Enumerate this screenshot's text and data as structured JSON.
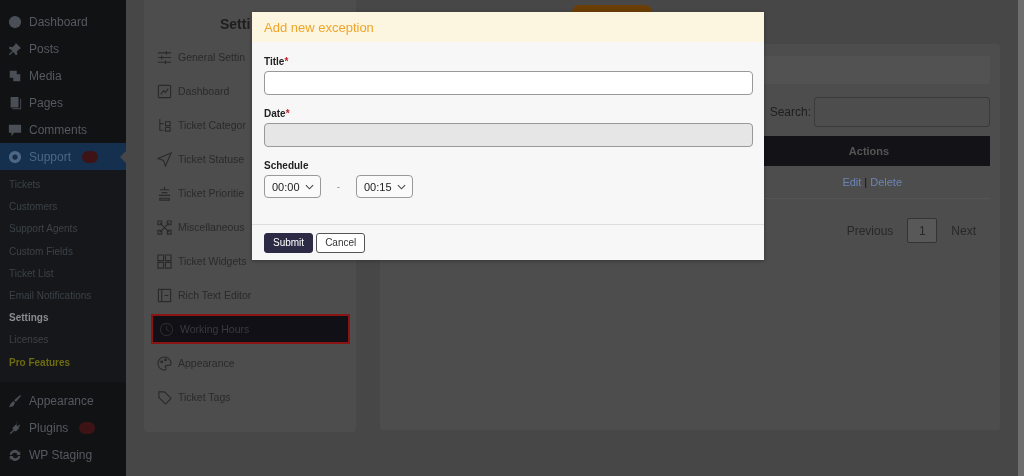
{
  "admin_menu": {
    "top": [
      {
        "label": "Dashboard",
        "selected": false,
        "badge": false
      },
      {
        "label": "Posts",
        "selected": false,
        "badge": false
      },
      {
        "label": "Media",
        "selected": false,
        "badge": false
      },
      {
        "label": "Pages",
        "selected": false,
        "badge": false
      },
      {
        "label": "Comments",
        "selected": false,
        "badge": false
      },
      {
        "label": "Support",
        "selected": true,
        "badge": true
      }
    ],
    "submenu": [
      {
        "label": "Tickets",
        "selected": false,
        "kind": "link"
      },
      {
        "label": "Customers",
        "selected": false,
        "kind": "link"
      },
      {
        "label": "Support Agents",
        "selected": false,
        "kind": "link"
      },
      {
        "label": "Custom Fields",
        "selected": false,
        "kind": "link"
      },
      {
        "label": "Ticket List",
        "selected": false,
        "kind": "link"
      },
      {
        "label": "Email Notifications",
        "selected": false,
        "kind": "link"
      },
      {
        "label": "Settings",
        "selected": true,
        "kind": "link"
      },
      {
        "label": "Licenses",
        "selected": false,
        "kind": "link"
      },
      {
        "label": "Pro Features",
        "selected": false,
        "kind": "pro"
      }
    ],
    "bottom": [
      {
        "label": "Appearance",
        "selected": false,
        "badge": false
      },
      {
        "label": "Plugins",
        "selected": false,
        "badge": true
      },
      {
        "label": "WP Staging",
        "selected": false,
        "badge": false
      }
    ]
  },
  "settings_panel": {
    "title": "Setti",
    "items": [
      {
        "label": "General Settin",
        "selected": false
      },
      {
        "label": "Dashboard",
        "selected": false
      },
      {
        "label": "Ticket Categor",
        "selected": false
      },
      {
        "label": "Ticket Statuse",
        "selected": false
      },
      {
        "label": "Ticket Prioritie",
        "selected": false
      },
      {
        "label": "Miscellaneous",
        "selected": false
      },
      {
        "label": "Ticket Widgets",
        "selected": false
      },
      {
        "label": "Rich Text Editor",
        "selected": false
      },
      {
        "label": "Working Hours",
        "selected": true
      },
      {
        "label": "Appearance",
        "selected": false
      },
      {
        "label": "Ticket Tags",
        "selected": false
      }
    ]
  },
  "exceptions_panel": {
    "search_label": "Search:",
    "columns": [
      "Actions"
    ],
    "rows": [
      {
        "edit": "Edit",
        "separator": "|",
        "delete": "Delete"
      }
    ],
    "pagination": {
      "previous": "Previous",
      "pages": [
        {
          "label": "1",
          "selected": true
        }
      ],
      "next": "Next"
    }
  },
  "modal": {
    "title": "Add new exception",
    "fields": [
      {
        "label": "Title",
        "required_mark": "*",
        "disabled": false
      },
      {
        "label": "Date",
        "required_mark": "*",
        "disabled": true
      }
    ],
    "schedule": {
      "label": "Schedule",
      "from": "00:00",
      "separator": "-",
      "to": "00:15"
    },
    "buttons": [
      {
        "label": "Submit",
        "kind": "primary"
      },
      {
        "label": "Cancel",
        "kind": "secondary"
      }
    ]
  }
}
